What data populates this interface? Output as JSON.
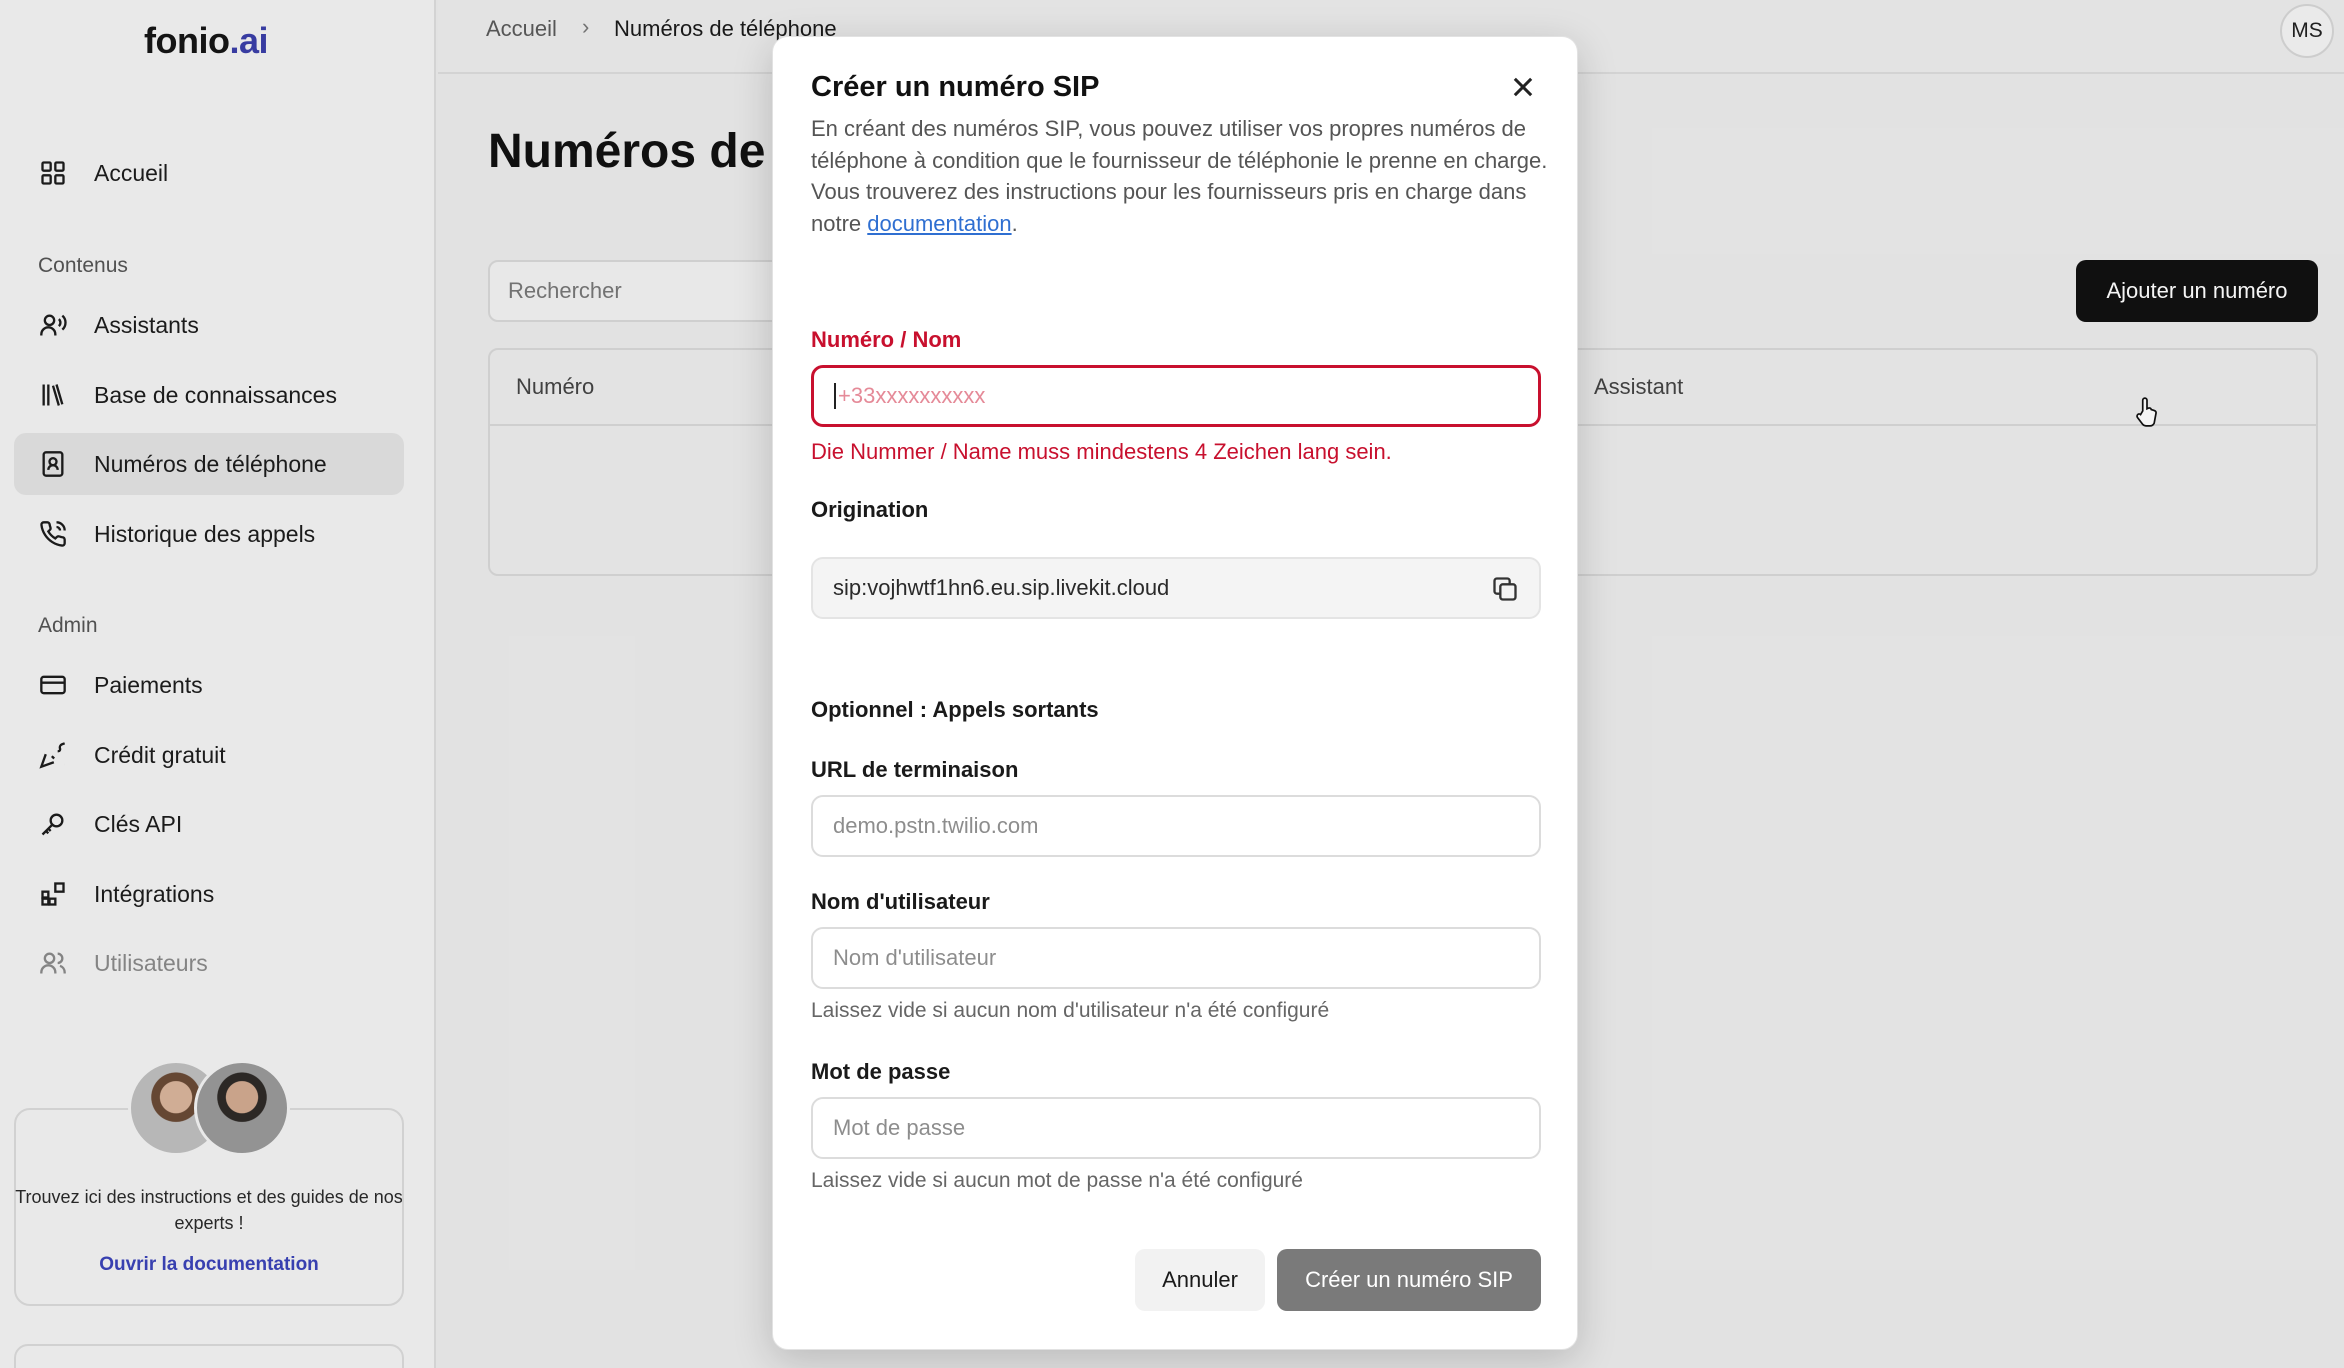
{
  "app": {
    "logo_main": "fonio",
    "logo_ai": ".ai"
  },
  "sidebar": {
    "items": [
      {
        "label": "Accueil",
        "icon": "grid-icon"
      },
      {
        "label": "Assistants",
        "icon": "user-voice-icon"
      },
      {
        "label": "Base de connaissances",
        "icon": "library-icon"
      },
      {
        "label": "Numéros de téléphone",
        "icon": "contact-book-icon",
        "active": true
      },
      {
        "label": "Historique des appels",
        "icon": "phone-call-icon"
      },
      {
        "label": "Paiements",
        "icon": "credit-card-icon"
      },
      {
        "label": "Crédit gratuit",
        "icon": "party-popper-icon"
      },
      {
        "label": "Clés API",
        "icon": "key-icon"
      },
      {
        "label": "Intégrations",
        "icon": "blocks-icon"
      },
      {
        "label": "Utilisateurs",
        "icon": "users-icon"
      }
    ],
    "section_content": "Contenus",
    "section_admin": "Admin",
    "help": {
      "text": "Trouvez ici des instructions et des guides de nos experts !",
      "link": "Ouvrir la documentation"
    }
  },
  "header": {
    "breadcrumb_home": "Accueil",
    "breadcrumb_sep": "›",
    "breadcrumb_current": "Numéros de téléphone",
    "user_initials": "MS"
  },
  "main": {
    "title": "Numéros de téléphone",
    "search_placeholder": "Rechercher",
    "add_button": "Ajouter un numéro",
    "columns": [
      "Numéro",
      "Assistant"
    ]
  },
  "modal": {
    "title": "Créer un numéro SIP",
    "desc_line1": "En créant des numéros SIP, vous pouvez utiliser vos propres numéros de téléphone à condition que le fournisseur de téléphonie le prenne en charge.",
    "desc_line2_pre": "Vous trouverez des instructions pour les fournisseurs pris en charge dans notre ",
    "desc_link": "documentation",
    "desc_line2_post": ".",
    "number_label": "Numéro / Nom",
    "number_placeholder": "+33xxxxxxxxxx",
    "number_error": "Die Nummer / Name muss mindestens 4 Zeichen lang sein.",
    "origination_label": "Origination",
    "origination_value": "sip:vojhwtf1hn6.eu.sip.livekit.cloud",
    "outbound_heading": "Optionnel : Appels sortants",
    "termination_label": "URL de terminaison",
    "termination_placeholder": "demo.pstn.twilio.com",
    "username_label": "Nom d'utilisateur",
    "username_placeholder": "Nom d'utilisateur",
    "username_hint": "Laissez vide si aucun nom d'utilisateur n'a été configuré",
    "password_label": "Mot de passe",
    "password_placeholder": "Mot de passe",
    "password_hint": "Laissez vide si aucun mot de passe n'a été configuré",
    "cancel_button": "Annuler",
    "create_button": "Créer un numéro SIP"
  },
  "colors": {
    "error": "#c8102e",
    "link": "#2f6fd1",
    "primary_dark": "#111111",
    "brand_ai": "#3b3fa8"
  }
}
